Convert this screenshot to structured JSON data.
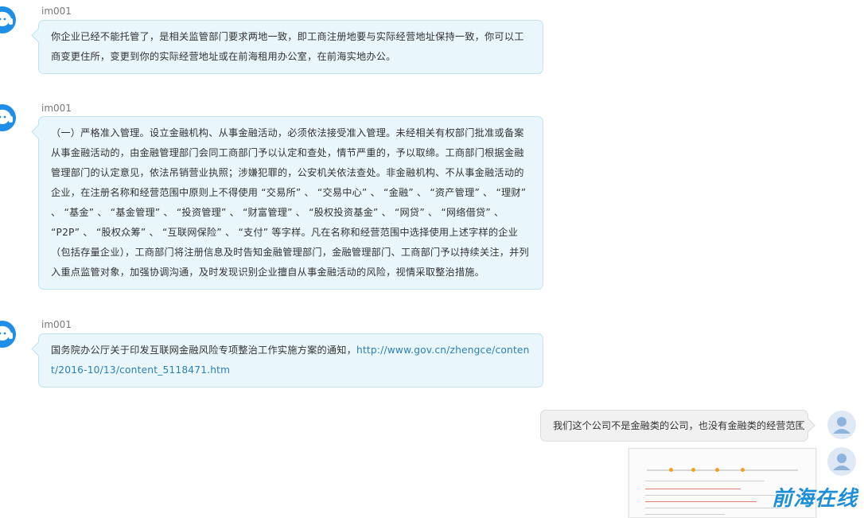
{
  "messages": [
    {
      "sender": "im001",
      "text": "你企业已经不能托管了，是相关监管部门要求两地一致，即工商注册地要与实际经营地址保持一致，你可以工商变更住所，变更到你的实际经营地址或在前海租用办公室，在前海实地办公。"
    },
    {
      "sender": "im001",
      "text": "（一）严格准入管理。设立金融机构、从事金融活动，必须依法接受准入管理。未经相关有权部门批准或备案从事金融活动的，由金融管理部门会同工商部门予以认定和查处，情节严重的，予以取缔。工商部门根据金融管理部门的认定意见，依法吊销营业执照；涉嫌犯罪的，公安机关依法查处。非金融机构、不从事金融活动的企业，在注册名称和经营范围中原则上不得使用 “交易所” 、 “交易中心” 、 “金融” 、 “资产管理” 、 “理财” 、 “基金” 、 “基金管理” 、 “投资管理” 、 “财富管理” 、 “股权投资基金” 、 “网贷” 、 “网络借贷” 、 “P2P” 、 “股权众筹” 、 “互联网保险” 、 “支付” 等字样。凡在名称和经营范围中选择使用上述字样的企业（包括存量企业），工商部门将注册信息及时告知金融管理部门，金融管理部门、工商部门予以持续关注，并列入重点监管对象，加强协调沟通，及时发现识别企业擅自从事金融活动的风险，视情采取整治措施。"
    },
    {
      "sender": "im001",
      "text": "国务院办公厅关于印发互联网金融风险专项整治工作实施方案的通知，",
      "link": "http://www.gov.cn/zhengce/content/2016-10/13/content_5118471.htm"
    }
  ],
  "user_message": {
    "text": "我们这个公司不是金融类的公司，也没有金融类的经营范围"
  },
  "watermark": "前海在线",
  "colors": {
    "agent_avatar": "#1f8ee6",
    "bubble_in_bg": "#e9f7fd",
    "bubble_out_bg": "#f1f1f1",
    "link": "#2a7fb5"
  },
  "icons": {
    "agent_avatar": "headset-agent-icon",
    "user_avatar": "user-icon"
  }
}
